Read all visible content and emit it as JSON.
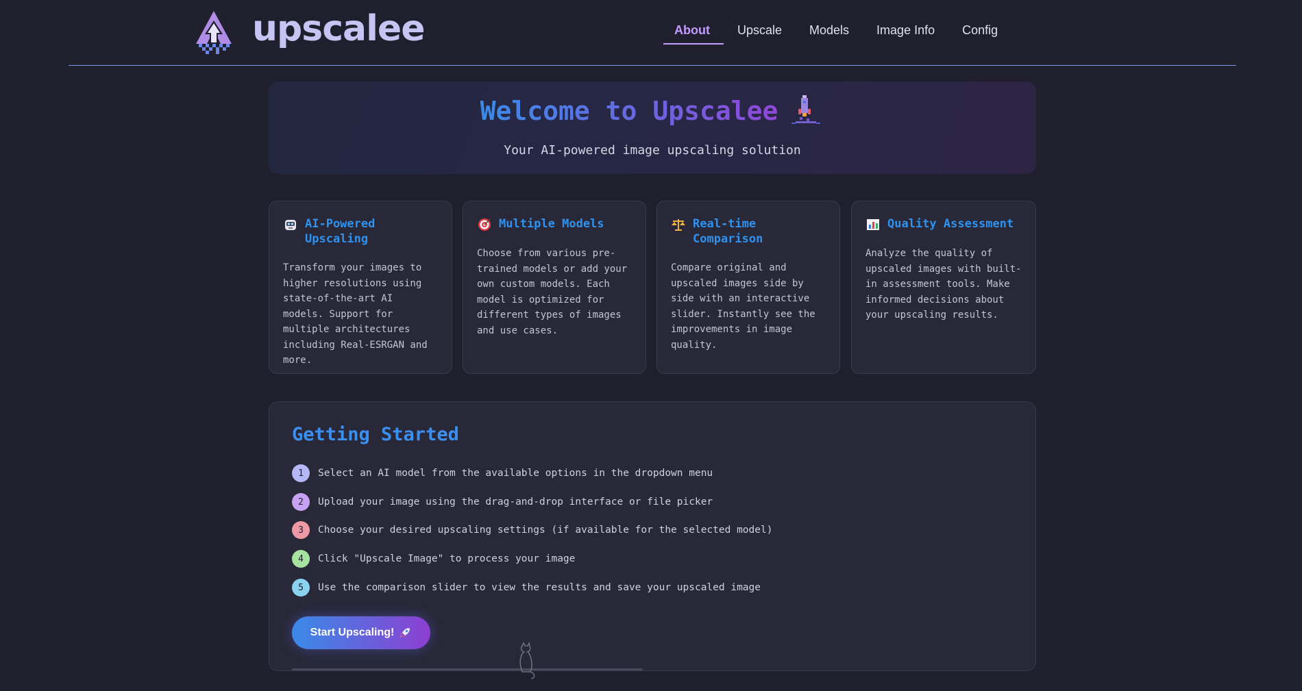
{
  "header": {
    "brand": "upscalee",
    "nav": [
      {
        "label": "About",
        "active": true
      },
      {
        "label": "Upscale",
        "active": false
      },
      {
        "label": "Models",
        "active": false
      },
      {
        "label": "Image Info",
        "active": false
      },
      {
        "label": "Config",
        "active": false
      }
    ]
  },
  "hero": {
    "title": "Welcome to Upscalee",
    "title_icon": "rocket-icon",
    "subtitle": "Your AI-powered image upscaling solution"
  },
  "features": [
    {
      "icon": "robot-face-icon",
      "title": "AI-Powered Upscaling",
      "description": "Transform your images to higher resolutions using state-of-the-art AI models. Support for multiple architectures including Real-ESRGAN and more."
    },
    {
      "icon": "target-icon",
      "title": "Multiple Models",
      "description": "Choose from various pre-trained models or add your own custom models. Each model is optimized for different types of images and use cases."
    },
    {
      "icon": "balance-scale-icon",
      "title": "Real-time Comparison",
      "description": "Compare original and upscaled images side by side with an interactive slider. Instantly see the improvements in image quality."
    },
    {
      "icon": "bar-chart-icon",
      "title": "Quality Assessment",
      "description": "Analyze the quality of upscaled images with built-in assessment tools. Make informed decisions about your upscaling results."
    }
  ],
  "getting_started": {
    "title": "Getting Started",
    "steps": [
      {
        "num": "1",
        "text": "Select an AI model from the available options in the dropdown menu",
        "color": "#b4b8f5"
      },
      {
        "num": "2",
        "text": "Upload your image using the drag-and-drop interface or file picker",
        "color": "#c8a2f2"
      },
      {
        "num": "3",
        "text": "Choose your desired upscaling settings (if available for the selected model)",
        "color": "#ee9aa6"
      },
      {
        "num": "4",
        "text": "Click \"Upscale Image\" to process your image",
        "color": "#a6e3a1"
      },
      {
        "num": "5",
        "text": "Use the comparison slider to view the results and save your upscaled image",
        "color": "#89d2f0"
      }
    ],
    "cta_label": "Start Upscaling!",
    "cta_icon": "rocket-icon"
  },
  "colors": {
    "background": "#1f1f2e",
    "accent_blue": "#2f92ee",
    "accent_purple": "#c49bff"
  }
}
